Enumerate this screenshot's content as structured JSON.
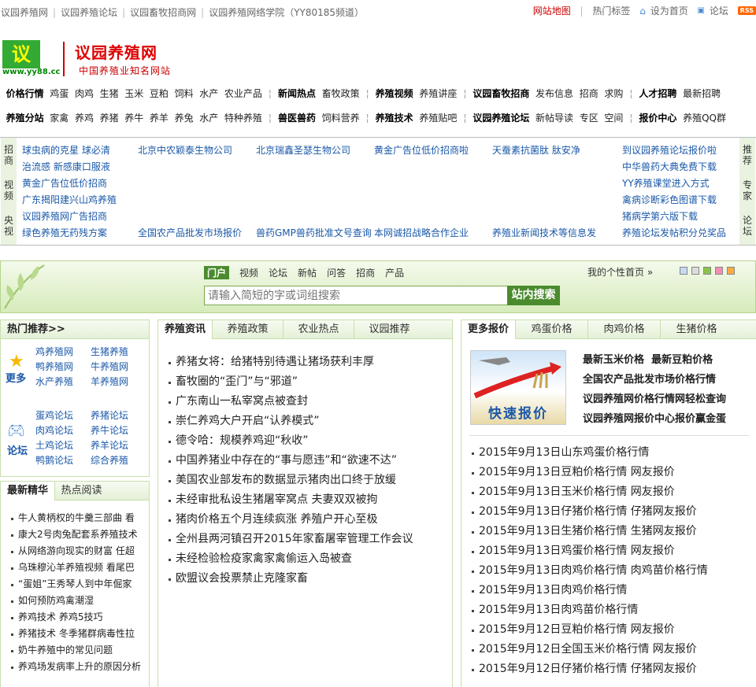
{
  "topbar": {
    "links": [
      "议园养殖网",
      "议园养殖论坛",
      "议园畜牧招商网",
      "议园养殖网络学院（YY80185频道）"
    ],
    "sitemap": "网站地图",
    "hot_tags": "热门标签",
    "set_home": "设为首页",
    "forum": "论坛",
    "rss": "RSS"
  },
  "logo": {
    "char": "议",
    "url": "www.yy88.cc",
    "name": "议园养殖网",
    "slogan": "中国养殖业知名网站"
  },
  "nav1": [
    {
      "head": "价格行情",
      "items": [
        "鸡蛋",
        "肉鸡",
        "生猪",
        "玉米",
        "豆粕",
        "饲料",
        "水产",
        "农业产品"
      ]
    },
    {
      "head": "新闻热点",
      "items": [
        "畜牧政策"
      ]
    },
    {
      "head": "养殖视频",
      "items": [
        "养殖讲座"
      ]
    },
    {
      "head": "议园畜牧招商",
      "items": [
        "发布信息",
        "招商",
        "求购"
      ]
    },
    {
      "head": "人才招聘",
      "items": [
        "最新招聘"
      ]
    }
  ],
  "nav2": [
    {
      "head": "养殖分站",
      "items": [
        "家禽",
        "养鸡",
        "养猪",
        "养牛",
        "养羊",
        "养兔",
        "水产",
        "特种养殖"
      ]
    },
    {
      "head": "兽医兽药",
      "items": [
        "饲料营养"
      ]
    },
    {
      "head": "养殖技术",
      "items": [
        "养殖贴吧"
      ]
    },
    {
      "head": "议园养殖论坛",
      "items": [
        "新帖导读",
        "专区",
        "空间"
      ]
    },
    {
      "head": "报价中心",
      "items": [
        "养殖QQ群"
      ]
    }
  ],
  "ad": {
    "left_tabs": [
      "招商",
      "视频",
      "央视"
    ],
    "right_tabs": [
      "推荐",
      "专家",
      "论坛"
    ],
    "col1": [
      "球虫病的克星 球必清",
      "治流感 新感康口服液",
      "黄金广告位低价招商",
      "广东揭阳建兴山鸡养殖",
      "议园养殖网广告招商",
      "绿色养殖无药残方案"
    ],
    "col2": [
      "北京中农颖泰生物公司",
      "",
      "",
      "",
      "",
      "全国农产品批发市场报价"
    ],
    "col3": [
      "北京瑞鑫圣瑟生物公司",
      "",
      "",
      "",
      "",
      "兽药GMP兽药批准文号查询"
    ],
    "col4": [
      "黄金广告位低价招商啦",
      "",
      "",
      "",
      "",
      "本网诚招战略合作企业"
    ],
    "col5": [
      "天蚕素抗菌肽 肽安净",
      "",
      "",
      "",
      "",
      "养殖业新闻技术等信息发"
    ],
    "col6": [
      "到议园养殖论坛报价啦",
      "中华兽药大典免费下载",
      "YY养殖课堂进入方式",
      "禽病诊断彩色图谱下载",
      "猪病学第六版下载",
      "养殖论坛发帖积分兑奖品"
    ]
  },
  "search": {
    "tabs": [
      "门户",
      "视频",
      "论坛",
      "新帖",
      "问答",
      "招商",
      "产品"
    ],
    "mine": "我的个性首页 »",
    "placeholder": "请输入简短的字或词组搜索",
    "button": "站内搜索"
  },
  "hot": {
    "title": "热门推荐>>",
    "more_label": "更多",
    "more": [
      "鸡养殖网",
      "生猪养殖",
      "鸭养殖网",
      "牛养殖网",
      "水产养殖",
      "羊养殖网"
    ],
    "forum_label": "论坛",
    "forum": [
      "蛋鸡论坛",
      "养猪论坛",
      "肉鸡论坛",
      "养牛论坛",
      "土鸡论坛",
      "养羊论坛",
      "鸭鹅论坛",
      "综合养殖"
    ]
  },
  "essence": {
    "tabs": [
      "最新精华",
      "热点阅读"
    ],
    "items": [
      "牛人黄柄权的牛羹三部曲 看",
      "康大2号肉兔配套系养殖技术",
      "从网络游向现实的财富 任超",
      "乌珠穆沁羊养殖视频 看尾巴",
      "“蛋姐”王秀琴人到中年倔家",
      "如何预防鸡禽潮湿",
      "养鸡技术 养鸡5技巧",
      "养猪技术 冬季猪群病毒性拉",
      "奶牛养殖中的常见问题",
      "养鸡场发病率上升的原因分析"
    ]
  },
  "news": {
    "tabs": [
      "养殖资讯",
      "养殖政策",
      "农业热点",
      "议园推荐"
    ],
    "items": [
      "养猪女将：给猪特别待遇让猪场获利丰厚",
      "畜牧圈的“歪门”与“邪道”",
      "广东南山一私宰窝点被查封",
      "崇仁养鸡大户开启“认养模式”",
      "德令哈：规模养鸡迎“秋收”",
      "中国养猪业中存在的“事与愿违”和“欲速不达”",
      "美国农业部发布的数据显示猪肉出口终于放缓",
      "未经审批私设生猪屠宰窝点 夫妻双双被拘",
      "猪肉价格五个月连续疯涨 养殖户开心至极",
      "全州县两河镇召开2015年家畜屠宰管理工作会议",
      "未经检验检疫家禽家禽偷运入岛被查",
      "欧盟议会投票禁止克隆家畜"
    ]
  },
  "prices": {
    "tabs": [
      "更多报价",
      "鸡蛋价格",
      "肉鸡价格",
      "生猪价格"
    ],
    "banner": "快速报价",
    "quick": [
      [
        "最新玉米价格",
        "最新豆粕价格"
      ],
      [
        "全国农产品批发市场价格行情"
      ],
      [
        "议园养殖网价格行情网轻松查询"
      ],
      [
        "议园养殖网报价中心报价赢金蛋"
      ]
    ],
    "items": [
      "2015年9月13日山东鸡蛋价格行情",
      "2015年9月13日豆粕价格行情 网友报价",
      "2015年9月13日玉米价格行情 网友报价",
      "2015年9月13日仔猪价格行情 仔猪网友报价",
      "2015年9月13日生猪价格行情 生猪网友报价",
      "2015年9月13日鸡蛋价格行情 网友报价",
      "2015年9月13日肉鸡价格行情 肉鸡苗价格行情",
      "2015年9月13日肉鸡价格行情",
      "2015年9月13日肉鸡苗价格行情",
      "2015年9月12日豆粕价格行情 网友报价",
      "2015年9月12日全国玉米价格行情 网友报价",
      "2015年9月12日仔猪价格行情 仔猪网友报价"
    ]
  },
  "colors": {
    "brand_red": "#d00",
    "green": "#4b8b2e",
    "link_blue": "#1a58a8"
  }
}
